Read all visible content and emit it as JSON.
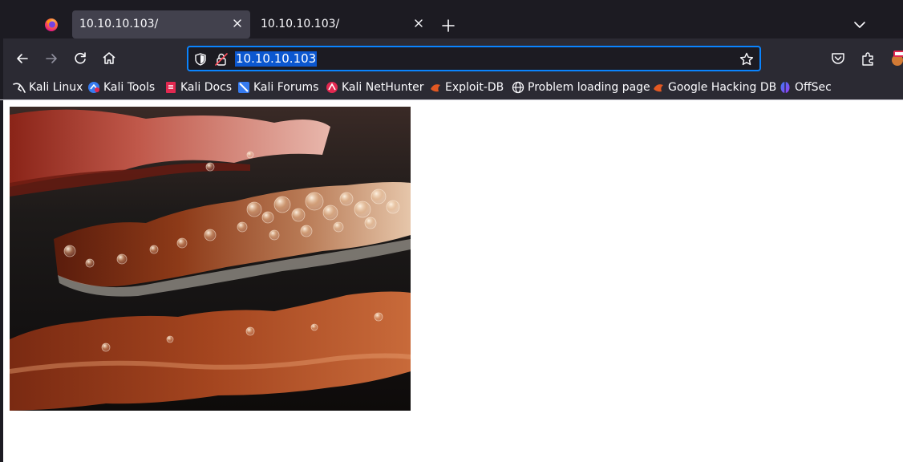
{
  "tabs": [
    {
      "title": "10.10.10.103/"
    },
    {
      "title": "10.10.10.103/"
    }
  ],
  "urlbar": {
    "value": "10.10.10.103"
  },
  "bookmarks": [
    {
      "label": "Kali Linux"
    },
    {
      "label": "Kali Tools"
    },
    {
      "label": "Kali Docs"
    },
    {
      "label": "Kali Forums"
    },
    {
      "label": "Kali NetHunter"
    },
    {
      "label": "Exploit-DB"
    },
    {
      "label": "Problem loading page"
    },
    {
      "label": "Google Hacking DB"
    },
    {
      "label": "OffSec"
    }
  ],
  "page": {
    "image_subject": "sizzling bacon strips"
  },
  "colors": {
    "accent": "#0a84ff",
    "chrome": "#2b2a33",
    "tabbar": "#1c1b22",
    "text": "#fbfbfe"
  }
}
